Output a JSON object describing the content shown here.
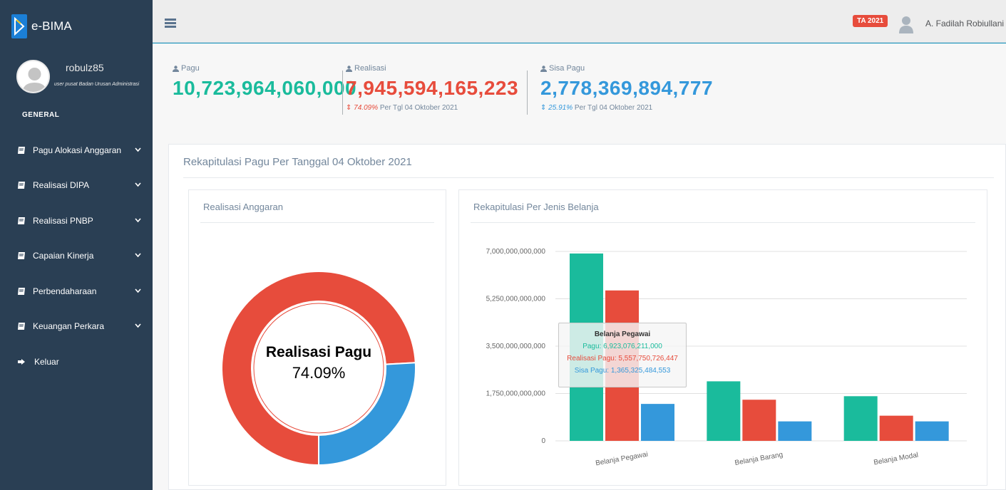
{
  "brand": {
    "name": "e-BIMA"
  },
  "profile": {
    "username": "robulz85",
    "role": "user pusat Badan Urusan Administrasi"
  },
  "sidebar": {
    "section": "GENERAL",
    "items": [
      {
        "label": "Pagu Alokasi Anggaran",
        "icon": "book-icon",
        "has_submenu": true
      },
      {
        "label": "Realisasi DIPA",
        "icon": "book-icon",
        "has_submenu": true
      },
      {
        "label": "Realisasi PNBP",
        "icon": "book-icon",
        "has_submenu": true
      },
      {
        "label": "Capaian Kinerja",
        "icon": "book-icon",
        "has_submenu": true
      },
      {
        "label": "Perbendaharaan",
        "icon": "book-icon",
        "has_submenu": true
      },
      {
        "label": "Keuangan Perkara",
        "icon": "book-icon",
        "has_submenu": true
      },
      {
        "label": "Keluar",
        "icon": "sign-out-icon",
        "has_submenu": false
      }
    ]
  },
  "topbar": {
    "year_badge": "TA 2021",
    "user_name": "A. Fadilah Robiullani"
  },
  "stats": {
    "pagu": {
      "label": "Pagu",
      "value": "10,723,964,060,000"
    },
    "realisasi": {
      "label": "Realisasi",
      "value": "7,945,594,165,223",
      "pct": "74.09%",
      "note": "Per Tgl 04 Oktober 2021"
    },
    "sisa": {
      "label": "Sisa Pagu",
      "value": "2,778,369,894,777",
      "pct": "25.91%",
      "note": "Per Tgl 04 Oktober 2021"
    }
  },
  "colors": {
    "green": "#1abb9c",
    "red": "#e74c3c",
    "blue": "#3498db",
    "sidebar": "#2a3f54"
  },
  "panel": {
    "title": "Rekapitulasi Pagu Per Tanggal 04 Oktober 2021"
  },
  "donut": {
    "title": "Realisasi Anggaran",
    "center_label": "Realisasi Pagu",
    "center_value": "74.09%"
  },
  "bar": {
    "title": "Rekapitulasi Per Jenis Belanja"
  },
  "tooltip": {
    "title": "Belanja Pegawai",
    "pagu": "Pagu: 6,923,076,211,000",
    "realisasi": "Realisasi Pagu: 5,557,750,726,447",
    "sisa": "Sisa Pagu: 1,365,325,484,553"
  },
  "chart_data": [
    {
      "type": "pie",
      "title": "Realisasi Anggaran",
      "labels": [
        "Realisasi",
        "Sisa Pagu"
      ],
      "values": [
        74.09,
        25.91
      ],
      "colors": [
        "#e74c3c",
        "#3498db"
      ]
    },
    {
      "type": "bar",
      "title": "Rekapitulasi Per Jenis Belanja",
      "categories": [
        "Belanja Pegawai",
        "Belanja Barang",
        "Belanja Modal"
      ],
      "series": [
        {
          "values": [
            6923076211000,
            2200000000000,
            1650000000000
          ],
          "color": "#1abb9c"
        },
        {
          "values": [
            5557750726447,
            1520000000000,
            930000000000
          ],
          "color": "#e74c3c"
        },
        {
          "values": [
            1365325484553,
            720000000000,
            720000000000
          ],
          "color": "#3498db"
        }
      ],
      "ylim": [
        0,
        7000000000000
      ],
      "yticks": [
        "0",
        "1,750,000,000,000",
        "3,500,000,000,000",
        "5,250,000,000,000",
        "7,000,000,000,000"
      ],
      "ytick_values": [
        0,
        1750000000000,
        3500000000000,
        5250000000000,
        7000000000000
      ],
      "grid": true
    }
  ]
}
